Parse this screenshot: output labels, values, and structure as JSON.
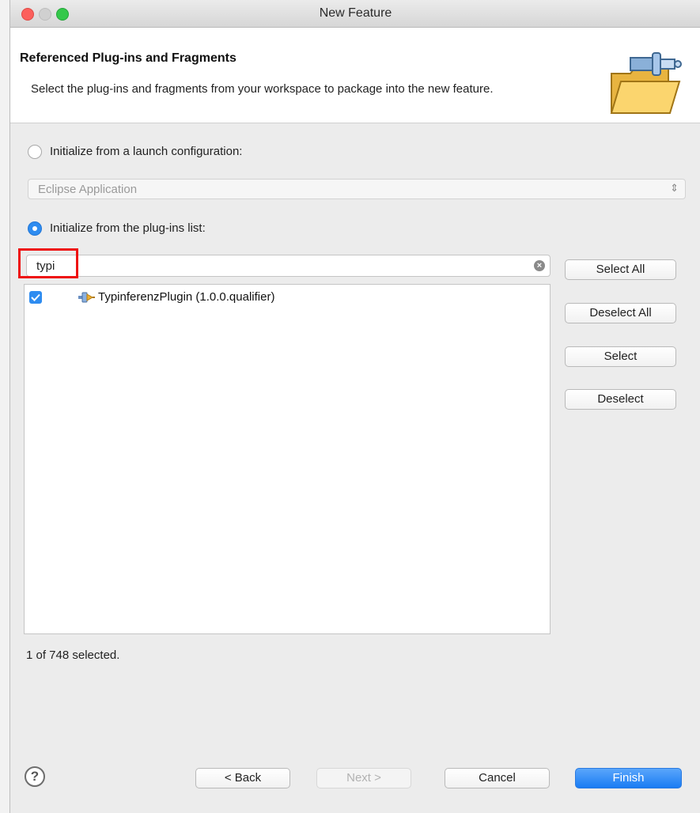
{
  "window": {
    "title": "New Feature"
  },
  "header": {
    "title": "Referenced Plug-ins and Fragments",
    "description": "Select the plug-ins and fragments from your workspace to package into the new feature.",
    "icon": "feature-folder-plug-icon"
  },
  "options": {
    "launch_config": {
      "label": "Initialize from a launch configuration:",
      "selected": false
    },
    "launch_select": {
      "value": "Eclipse Application",
      "enabled": false
    },
    "plugins_list": {
      "label": "Initialize from the plug-ins list:",
      "selected": true
    }
  },
  "filter": {
    "value": "typi"
  },
  "plugins": [
    {
      "label": "TypinferenzPlugin (1.0.0.qualifier)",
      "checked": true,
      "icon": "plugin-icon"
    }
  ],
  "side_buttons": {
    "select_all": "Select All",
    "deselect_all": "Deselect All",
    "select": "Select",
    "deselect": "Deselect"
  },
  "status": "1 of 748 selected.",
  "footer": {
    "help": "?",
    "back": "< Back",
    "next": "Next >",
    "cancel": "Cancel",
    "finish": "Finish"
  },
  "colors": {
    "accent": "#2e8cf0",
    "highlight": "#e11111"
  }
}
